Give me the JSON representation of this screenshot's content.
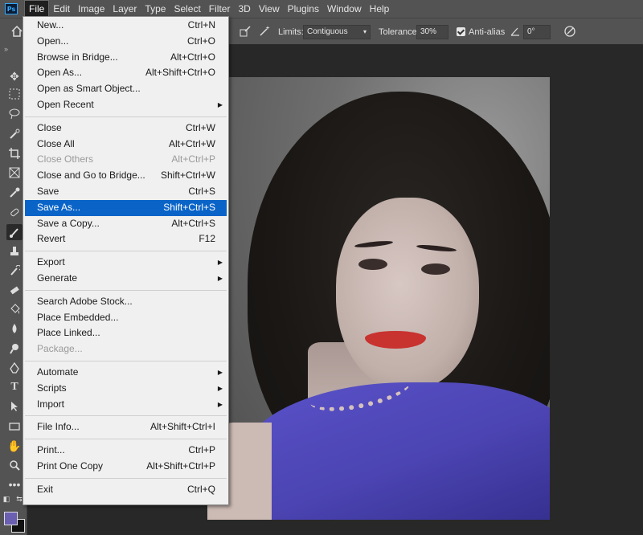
{
  "app": {
    "logo_text": "Ps"
  },
  "menubar": {
    "items": [
      "File",
      "Edit",
      "Image",
      "Layer",
      "Type",
      "Select",
      "Filter",
      "3D",
      "View",
      "Plugins",
      "Window",
      "Help"
    ]
  },
  "options": {
    "limits_label": "Limits:",
    "limits_value": "Contiguous",
    "tolerance_label": "Tolerance:",
    "tolerance_value": "30%",
    "antialias_label": "Anti-alias",
    "angle_value": "0°"
  },
  "toolbar": {
    "collapse_glyph": "»"
  },
  "file_menu": {
    "group1": [
      {
        "label": "New...",
        "shortcut": "Ctrl+N"
      },
      {
        "label": "Open...",
        "shortcut": "Ctrl+O"
      },
      {
        "label": "Browse in Bridge...",
        "shortcut": "Alt+Ctrl+O"
      },
      {
        "label": "Open As...",
        "shortcut": "Alt+Shift+Ctrl+O"
      },
      {
        "label": "Open as Smart Object...",
        "shortcut": ""
      },
      {
        "label": "Open Recent",
        "shortcut": ""
      }
    ],
    "group2": [
      {
        "label": "Close",
        "shortcut": "Ctrl+W"
      },
      {
        "label": "Close All",
        "shortcut": "Alt+Ctrl+W"
      },
      {
        "label": "Close Others",
        "shortcut": "Alt+Ctrl+P"
      },
      {
        "label": "Close and Go to Bridge...",
        "shortcut": "Shift+Ctrl+W"
      },
      {
        "label": "Save",
        "shortcut": "Ctrl+S"
      },
      {
        "label": "Save As...",
        "shortcut": "Shift+Ctrl+S"
      },
      {
        "label": "Save a Copy...",
        "shortcut": "Alt+Ctrl+S"
      },
      {
        "label": "Revert",
        "shortcut": "F12"
      }
    ],
    "group3": [
      {
        "label": "Export",
        "shortcut": ""
      },
      {
        "label": "Generate",
        "shortcut": ""
      }
    ],
    "group4": [
      {
        "label": "Search Adobe Stock...",
        "shortcut": ""
      },
      {
        "label": "Place Embedded...",
        "shortcut": ""
      },
      {
        "label": "Place Linked...",
        "shortcut": ""
      },
      {
        "label": "Package...",
        "shortcut": ""
      }
    ],
    "group5": [
      {
        "label": "Automate",
        "shortcut": ""
      },
      {
        "label": "Scripts",
        "shortcut": ""
      },
      {
        "label": "Import",
        "shortcut": ""
      }
    ],
    "group6": [
      {
        "label": "File Info...",
        "shortcut": "Alt+Shift+Ctrl+I"
      }
    ],
    "group7": [
      {
        "label": "Print...",
        "shortcut": "Ctrl+P"
      },
      {
        "label": "Print One Copy",
        "shortcut": "Alt+Shift+Ctrl+P"
      }
    ],
    "group8": [
      {
        "label": "Exit",
        "shortcut": "Ctrl+Q"
      }
    ]
  },
  "colors": {
    "highlight": "#0a64c8",
    "foreground_swatch": "#6a5fb0",
    "background_swatch": "#111111"
  }
}
